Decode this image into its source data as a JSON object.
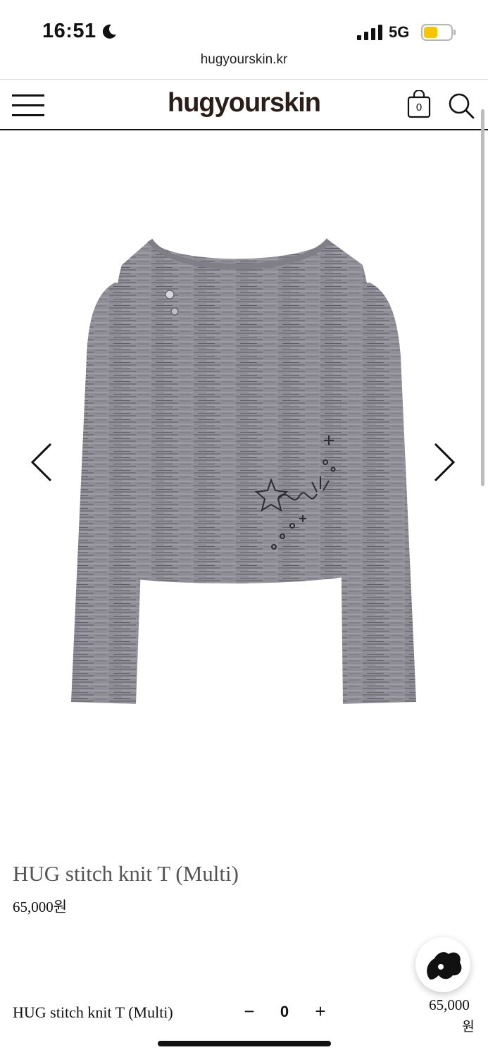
{
  "status_bar": {
    "time": "16:51",
    "network": "5G"
  },
  "browser": {
    "url": "hugyourskin.kr"
  },
  "header": {
    "logo": "hugyourskin",
    "cart_count": "0"
  },
  "product": {
    "title": "HUG stitch knit T (Multi)",
    "price": "65,000원"
  },
  "purchase_bar": {
    "name": "HUG stitch knit T (Multi)",
    "minus": "−",
    "quantity": "0",
    "plus": "+",
    "total": "65,000",
    "currency": "원"
  },
  "icons": {
    "menu": "hamburger-icon",
    "cart": "shopping-bag-icon",
    "search": "search-icon",
    "prev": "chevron-left-icon",
    "next": "chevron-right-icon",
    "fab": "brand-blob-icon"
  },
  "colors": {
    "battery": "#f7c600",
    "garment": "#8a8890"
  }
}
